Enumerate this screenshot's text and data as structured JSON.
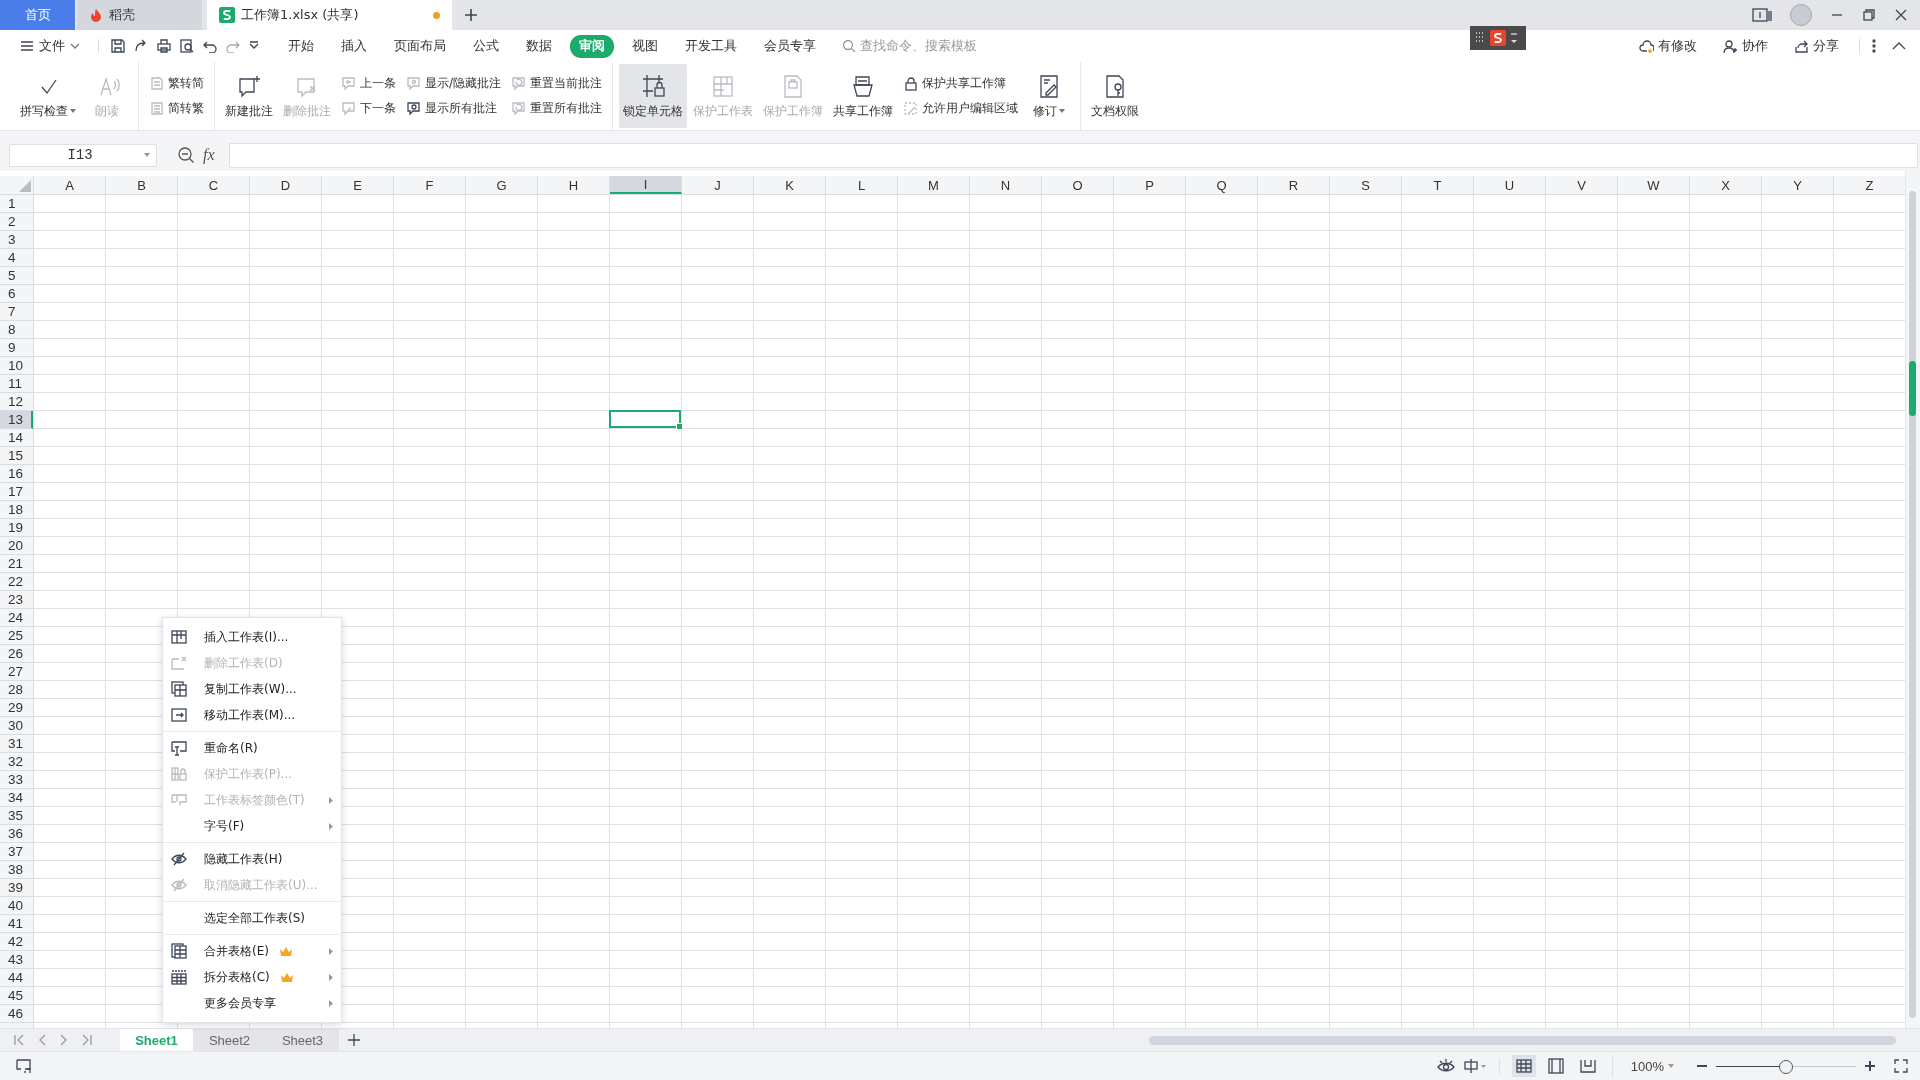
{
  "title_tabs": [
    {
      "kind": "home",
      "label": "首页",
      "selected": false,
      "modified": false
    },
    {
      "kind": "docer",
      "label": "稻壳",
      "selected": false,
      "modified": false
    },
    {
      "kind": "workbook",
      "label": "工作簿1.xlsx (共享)",
      "selected": true,
      "modified": true
    }
  ],
  "menu_bar": {
    "file_label": "文件",
    "tabs": [
      {
        "label": "开始",
        "selected": false
      },
      {
        "label": "插入",
        "selected": false
      },
      {
        "label": "页面布局",
        "selected": false
      },
      {
        "label": "公式",
        "selected": false
      },
      {
        "label": "数据",
        "selected": false
      },
      {
        "label": "审阅",
        "selected": true
      },
      {
        "label": "视图",
        "selected": false
      },
      {
        "label": "开发工具",
        "selected": false
      },
      {
        "label": "会员专享",
        "selected": false
      }
    ],
    "search": {
      "placeholder": "查找命令、搜索模板"
    },
    "actions": [
      {
        "kind": "cloud",
        "label": "有修改"
      },
      {
        "kind": "collaborate",
        "label": "协作"
      },
      {
        "kind": "share",
        "label": "分享"
      }
    ]
  },
  "ribbon": {
    "groups": [
      {
        "items": [
          {
            "kind": "large",
            "label": "拼写检查",
            "disabled": false,
            "pressed": false,
            "dropdown": true
          },
          {
            "kind": "large",
            "label": "朗读",
            "disabled": true,
            "pressed": false,
            "dropdown": false
          }
        ]
      },
      {
        "items": [
          {
            "kind": "stack",
            "entries": [
              {
                "label": "繁转简",
                "disabled": true
              },
              {
                "label": "简转繁",
                "disabled": true
              }
            ]
          }
        ]
      },
      {
        "items": [
          {
            "kind": "large",
            "label": "新建批注",
            "disabled": false,
            "pressed": false,
            "dropdown": false
          },
          {
            "kind": "large",
            "label": "删除批注",
            "disabled": true,
            "pressed": false,
            "dropdown": false
          },
          {
            "kind": "stack",
            "entries": [
              {
                "label": "上一条",
                "disabled": true
              },
              {
                "label": "下一条",
                "disabled": true
              }
            ]
          },
          {
            "kind": "stack",
            "entries": [
              {
                "label": "显示/隐藏批注",
                "disabled": true
              },
              {
                "label": "显示所有批注",
                "disabled": false
              }
            ]
          },
          {
            "kind": "stack",
            "entries": [
              {
                "label": "重置当前批注",
                "disabled": true
              },
              {
                "label": "重置所有批注",
                "disabled": true
              }
            ]
          }
        ]
      },
      {
        "items": [
          {
            "kind": "large",
            "label": "锁定单元格",
            "disabled": false,
            "pressed": true,
            "dropdown": false
          },
          {
            "kind": "large",
            "label": "保护工作表",
            "disabled": true,
            "pressed": false,
            "dropdown": false
          },
          {
            "kind": "large",
            "label": "保护工作簿",
            "disabled": true,
            "pressed": false,
            "dropdown": false
          },
          {
            "kind": "large",
            "label": "共享工作簿",
            "disabled": false,
            "pressed": false,
            "dropdown": false
          },
          {
            "kind": "stack",
            "entries": [
              {
                "label": "保护共享工作簿",
                "disabled": false
              },
              {
                "label": "允许用户编辑区域",
                "disabled": true
              }
            ]
          },
          {
            "kind": "large",
            "label": "修订",
            "disabled": false,
            "pressed": false,
            "dropdown": true
          }
        ]
      },
      {
        "items": [
          {
            "kind": "large",
            "label": "文档权限",
            "disabled": false,
            "pressed": false,
            "dropdown": false
          }
        ]
      }
    ]
  },
  "formula_bar": {
    "name_box": "I13",
    "function_label": "fx"
  },
  "sheet": {
    "columns": [
      {
        "label": "A",
        "selected": false
      },
      {
        "label": "B",
        "selected": false
      },
      {
        "label": "C",
        "selected": false
      },
      {
        "label": "D",
        "selected": false
      },
      {
        "label": "E",
        "selected": false
      },
      {
        "label": "F",
        "selected": false
      },
      {
        "label": "G",
        "selected": false
      },
      {
        "label": "H",
        "selected": false
      },
      {
        "label": "I",
        "selected": true
      },
      {
        "label": "J",
        "selected": false
      },
      {
        "label": "K",
        "selected": false
      },
      {
        "label": "L",
        "selected": false
      },
      {
        "label": "M",
        "selected": false
      },
      {
        "label": "N",
        "selected": false
      },
      {
        "label": "O",
        "selected": false
      },
      {
        "label": "P",
        "selected": false
      },
      {
        "label": "Q",
        "selected": false
      },
      {
        "label": "R",
        "selected": false
      },
      {
        "label": "S",
        "selected": false
      },
      {
        "label": "T",
        "selected": false
      },
      {
        "label": "U",
        "selected": false
      },
      {
        "label": "V",
        "selected": false
      },
      {
        "label": "W",
        "selected": false
      },
      {
        "label": "X",
        "selected": false
      },
      {
        "label": "Y",
        "selected": false
      },
      {
        "label": "Z",
        "selected": false
      }
    ],
    "rows": [
      {
        "label": "1",
        "selected": false
      },
      {
        "label": "2",
        "selected": false
      },
      {
        "label": "3",
        "selected": false
      },
      {
        "label": "4",
        "selected": false
      },
      {
        "label": "5",
        "selected": false
      },
      {
        "label": "6",
        "selected": false
      },
      {
        "label": "7",
        "selected": false
      },
      {
        "label": "8",
        "selected": false
      },
      {
        "label": "9",
        "selected": false
      },
      {
        "label": "10",
        "selected": false
      },
      {
        "label": "11",
        "selected": false
      },
      {
        "label": "12",
        "selected": false
      },
      {
        "label": "13",
        "selected": true
      },
      {
        "label": "14",
        "selected": false
      },
      {
        "label": "15",
        "selected": false
      },
      {
        "label": "16",
        "selected": false
      },
      {
        "label": "17",
        "selected": false
      },
      {
        "label": "18",
        "selected": false
      },
      {
        "label": "19",
        "selected": false
      },
      {
        "label": "20",
        "selected": false
      },
      {
        "label": "21",
        "selected": false
      },
      {
        "label": "22",
        "selected": false
      },
      {
        "label": "23",
        "selected": false
      },
      {
        "label": "24",
        "selected": false
      },
      {
        "label": "25",
        "selected": false
      },
      {
        "label": "26",
        "selected": false
      },
      {
        "label": "27",
        "selected": false
      },
      {
        "label": "28",
        "selected": false
      },
      {
        "label": "29",
        "selected": false
      },
      {
        "label": "30",
        "selected": false
      },
      {
        "label": "31",
        "selected": false
      },
      {
        "label": "32",
        "selected": false
      },
      {
        "label": "33",
        "selected": false
      },
      {
        "label": "34",
        "selected": false
      },
      {
        "label": "35",
        "selected": false
      },
      {
        "label": "36",
        "selected": false
      },
      {
        "label": "37",
        "selected": false
      },
      {
        "label": "38",
        "selected": false
      },
      {
        "label": "39",
        "selected": false
      },
      {
        "label": "40",
        "selected": false
      },
      {
        "label": "41",
        "selected": false
      },
      {
        "label": "42",
        "selected": false
      },
      {
        "label": "43",
        "selected": false
      },
      {
        "label": "44",
        "selected": false
      },
      {
        "label": "45",
        "selected": false
      },
      {
        "label": "46",
        "selected": false
      }
    ]
  },
  "context_menu": {
    "sections": [
      [
        {
          "kind": "insert",
          "label": "插入工作表(I)...",
          "disabled": false,
          "submenu": false,
          "premium": false
        },
        {
          "kind": "delete",
          "label": "删除工作表(D)",
          "disabled": true,
          "submenu": false,
          "premium": false
        },
        {
          "kind": "copy",
          "label": "复制工作表(W)...",
          "disabled": false,
          "submenu": false,
          "premium": false
        },
        {
          "kind": "move",
          "label": "移动工作表(M)...",
          "disabled": false,
          "submenu": false,
          "premium": false
        }
      ],
      [
        {
          "kind": "rename",
          "label": "重命名(R)",
          "disabled": false,
          "submenu": false,
          "premium": false
        },
        {
          "kind": "protect",
          "label": "保护工作表(P)...",
          "disabled": true,
          "submenu": false,
          "premium": false
        },
        {
          "kind": "tab-color",
          "label": "工作表标签颜色(T)",
          "disabled": true,
          "submenu": true,
          "premium": false
        },
        {
          "kind": "plain",
          "label": "字号(F)",
          "disabled": false,
          "submenu": true,
          "premium": false
        }
      ],
      [
        {
          "kind": "hide",
          "label": "隐藏工作表(H)",
          "disabled": false,
          "submenu": false,
          "premium": false
        },
        {
          "kind": "hide",
          "label": "取消隐藏工作表(U)...",
          "disabled": true,
          "submenu": false,
          "premium": false
        }
      ],
      [
        {
          "kind": "plain",
          "label": "选定全部工作表(S)",
          "disabled": false,
          "submenu": false,
          "premium": false
        }
      ],
      [
        {
          "kind": "merge",
          "label": "合并表格(E)",
          "disabled": false,
          "submenu": true,
          "premium": true
        },
        {
          "kind": "split",
          "label": "拆分表格(C)",
          "disabled": false,
          "submenu": true,
          "premium": true
        },
        {
          "kind": "plain",
          "label": "更多会员专享",
          "disabled": false,
          "submenu": true,
          "premium": false
        }
      ]
    ]
  },
  "sheet_tabs": [
    {
      "label": "Sheet1",
      "selected": true
    },
    {
      "label": "Sheet2",
      "selected": false
    },
    {
      "label": "Sheet3",
      "selected": false
    }
  ],
  "status_bar": {
    "view_modes": [
      {
        "kind": "normal",
        "selected": true
      },
      {
        "kind": "page-break",
        "selected": false
      },
      {
        "kind": "reading",
        "selected": false
      }
    ],
    "zoom": "100%",
    "zoom_slider": {
      "level": 0.5
    }
  }
}
